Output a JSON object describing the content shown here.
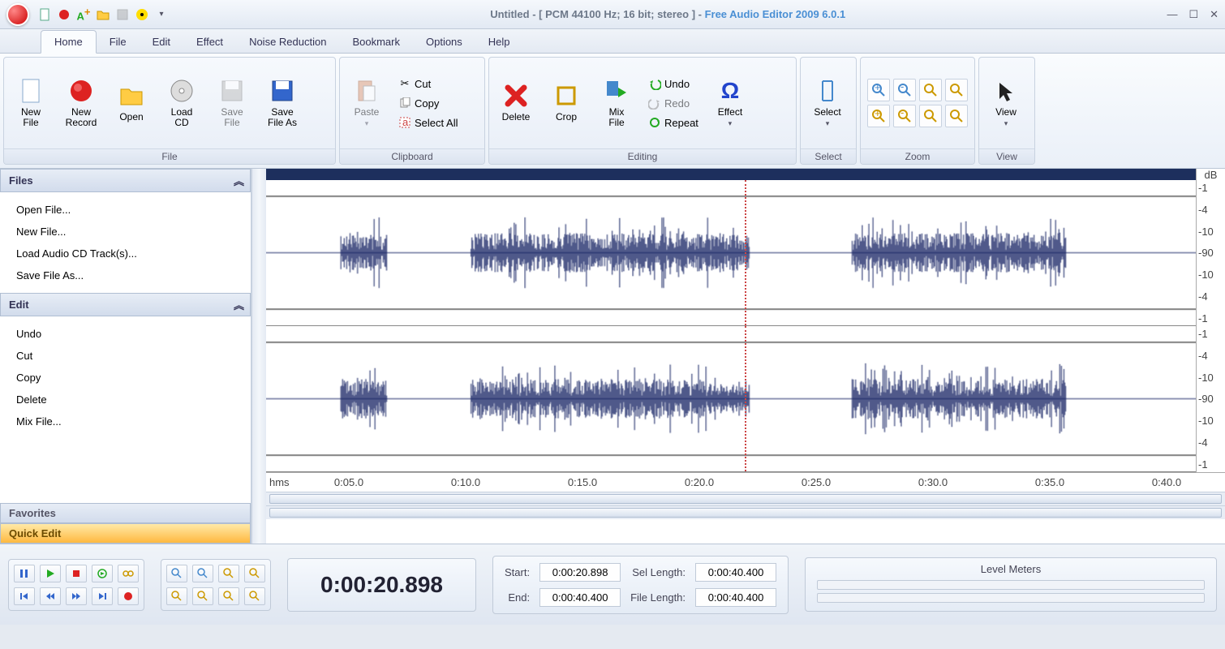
{
  "title": {
    "document": "Untitled - [ PCM 44100 Hz; 16 bit; stereo ] - ",
    "app": "Free Audio Editor 2009 6.0.1"
  },
  "menu": {
    "tabs": [
      "Home",
      "File",
      "Edit",
      "Effect",
      "Noise Reduction",
      "Bookmark",
      "Options",
      "Help"
    ],
    "active": 0
  },
  "ribbon": {
    "file": {
      "label": "File",
      "buttons": {
        "new_file": "New\nFile",
        "new_record": "New\nRecord",
        "open": "Open",
        "load_cd": "Load\nCD",
        "save_file": "Save\nFile",
        "save_file_as": "Save\nFile As"
      }
    },
    "clipboard": {
      "label": "Clipboard",
      "paste": "Paste",
      "cut": "Cut",
      "copy": "Copy",
      "select_all": "Select All"
    },
    "editing": {
      "label": "Editing",
      "delete": "Delete",
      "crop": "Crop",
      "mix_file": "Mix\nFile",
      "undo": "Undo",
      "redo": "Redo",
      "repeat": "Repeat",
      "effect": "Effect"
    },
    "select": {
      "label": "Select",
      "button": "Select"
    },
    "zoom": {
      "label": "Zoom"
    },
    "view": {
      "label": "View",
      "button": "View"
    }
  },
  "sidebar": {
    "files": {
      "header": "Files",
      "items": [
        "Open File...",
        "New File...",
        "Load Audio CD Track(s)...",
        "Save File As..."
      ]
    },
    "edit": {
      "header": "Edit",
      "items": [
        "Undo",
        "Cut",
        "Copy",
        "Delete",
        "Mix File..."
      ]
    },
    "favorites": "Favorites",
    "quick_edit": "Quick Edit"
  },
  "waveform": {
    "db_unit": "dB",
    "db_labels": [
      "-1",
      "-4",
      "-10",
      "-90",
      "-10",
      "-4",
      "-1"
    ],
    "time_unit": "hms",
    "time_ticks": [
      "0:05.0",
      "0:10.0",
      "0:15.0",
      "0:20.0",
      "0:25.0",
      "0:30.0",
      "0:35.0",
      "0:40.0"
    ],
    "cursor_position_fraction": 0.515
  },
  "status": {
    "current_time": "0:00:20.898",
    "start_label": "Start:",
    "start_value": "0:00:20.898",
    "end_label": "End:",
    "end_value": "0:00:40.400",
    "sel_length_label": "Sel Length:",
    "sel_length_value": "0:00:40.400",
    "file_length_label": "File Length:",
    "file_length_value": "0:00:40.400",
    "meters": "Level Meters"
  }
}
